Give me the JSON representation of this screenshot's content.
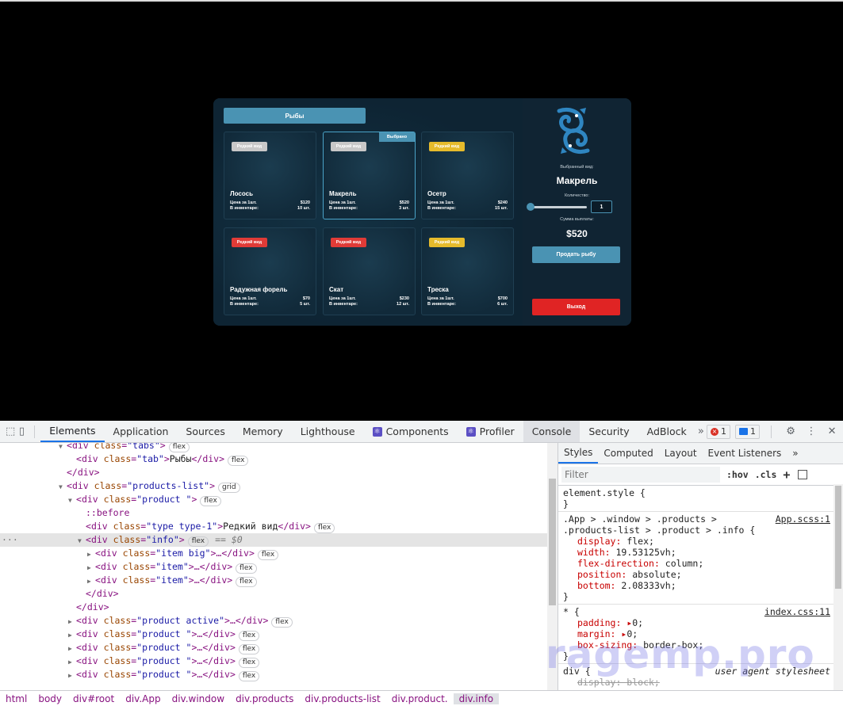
{
  "app": {
    "tab_label": "Рыбы",
    "selected_badge": "Выбрано",
    "price_label": "Цена за 1шт.",
    "inventory_label": "В инвентаре:",
    "products": [
      {
        "name": "Лосось",
        "type_label": "Редкий вид",
        "type_color": "#c8c8c8",
        "price": "$120",
        "qty": "10 шт."
      },
      {
        "name": "Макрель",
        "type_label": "Редкий вид",
        "type_color": "#c8c8c8",
        "price": "$520",
        "qty": "3 шт.",
        "active": true
      },
      {
        "name": "Осетр",
        "type_label": "Редкий вид",
        "type_color": "#e6bb2c",
        "price": "$240",
        "qty": "15 шт."
      },
      {
        "name": "Радужная форель",
        "type_label": "Редкий вид",
        "type_color": "#e03b37",
        "price": "$70",
        "qty": "5 шт."
      },
      {
        "name": "Скат",
        "type_label": "Редкий вид",
        "type_color": "#e03b37",
        "price": "$230",
        "qty": "12 шт."
      },
      {
        "name": "Треска",
        "type_label": "Редкий вид",
        "type_color": "#e6bb2c",
        "price": "$700",
        "qty": "6 шт."
      }
    ],
    "side": {
      "selected_label": "Выбранный вид:",
      "selected_name": "Макрель",
      "quantity_label": "Количество:",
      "quantity_value": "1",
      "payout_label": "Сумма выплаты:",
      "payout_value": "$520",
      "sell_button": "Продать рыбу",
      "exit_button": "Выход"
    }
  },
  "devtools": {
    "tabs": [
      "Elements",
      "Application",
      "Sources",
      "Memory",
      "Lighthouse",
      "Components",
      "Profiler",
      "Console",
      "Security",
      "AdBlock"
    ],
    "more_tabs": "»",
    "error_count": "1",
    "message_count": "1",
    "dom_lines": {
      "l1_tag": "div",
      "l1_attr": "class",
      "l1_val": "\"tabs\"",
      "l1_pill": "flex",
      "l2_tag": "div",
      "l2_attr": "class",
      "l2_val": "\"tab\"",
      "l2_text": "Рыбы",
      "l2_close": "</div>",
      "l2_pill": "flex",
      "l3": "</div>",
      "l4_tag": "div",
      "l4_attr": "class",
      "l4_val": "\"products-list\"",
      "l4_pill": "grid",
      "l5_tag": "div",
      "l5_attr": "class",
      "l5_val": "\"product \"",
      "l5_pill": "flex",
      "l6": "::before",
      "l7_tag": "div",
      "l7_attr": "class",
      "l7_val": "\"type type-1\"",
      "l7_text": "Редкий вид",
      "l7_close": "</div>",
      "l7_pill": "flex",
      "l8_tag": "div",
      "l8_attr": "class",
      "l8_val": "\"info\"",
      "l8_pill": "flex",
      "l8_eq": "== $0",
      "l9_tag": "div",
      "l9_attr": "class",
      "l9_val": "\"item big\"",
      "l9_rest": "…</div>",
      "l9_pill": "flex",
      "l10_tag": "div",
      "l10_attr": "class",
      "l10_val": "\"item\"",
      "l10_rest": "…</div>",
      "l10_pill": "flex",
      "l11_tag": "div",
      "l11_attr": "class",
      "l11_val": "\"item\"",
      "l11_rest": "…</div>",
      "l11_pill": "flex",
      "l12": "</div>",
      "l13": "</div>",
      "l14_tag": "div",
      "l14_attr": "class",
      "l14_val": "\"product active\"",
      "l14_rest": "…</div>",
      "l14_pill": "flex",
      "l15_tag": "div",
      "l15_attr": "class",
      "l15_val": "\"product \"",
      "l15_rest": "…</div>",
      "l15_pill": "flex",
      "l16_tag": "div",
      "l16_attr": "class",
      "l16_val": "\"product \"",
      "l16_rest": "…</div>",
      "l16_pill": "flex",
      "l17_tag": "div",
      "l17_attr": "class",
      "l17_val": "\"product \"",
      "l17_rest": "…</div>",
      "l17_pill": "flex",
      "l18_tag": "div",
      "l18_attr": "class",
      "l18_val": "\"product \"",
      "l18_rest": "…</div>",
      "l18_pill": "flex"
    },
    "breadcrumbs": [
      "html",
      "body",
      "div#root",
      "div.App",
      "div.window",
      "div.products",
      "div.products-list",
      "div.product.",
      "div.info"
    ],
    "styles": {
      "tabs": [
        "Styles",
        "Computed",
        "Layout",
        "Event Listeners"
      ],
      "more": "»",
      "filter_placeholder": "Filter",
      "hov": ":hov",
      "cls": ".cls",
      "element_style": "element.style {",
      "close_brace": "}",
      "rule1_selector_1": ".App > .window > .products >",
      "rule1_selector_2": ".products-list > .product > .info {",
      "rule1_source": "App.scss:1",
      "rule1_props": [
        {
          "name": "display",
          "value": "flex;"
        },
        {
          "name": "width",
          "value": "19.53125vh;"
        },
        {
          "name": "flex-direction",
          "value": "column;"
        },
        {
          "name": "position",
          "value": "absolute;"
        },
        {
          "name": "bottom",
          "value": "2.08333vh;"
        }
      ],
      "rule2_selector": "* {",
      "rule2_source": "index.css:11",
      "rule2_props": [
        {
          "name": "padding",
          "value": "0;"
        },
        {
          "name": "margin",
          "value": "0;"
        },
        {
          "name": "box-sizing",
          "value": "border-box;"
        }
      ],
      "rule3_selector": "div {",
      "rule3_source": "user agent stylesheet",
      "rule3_prop": "display: block;"
    },
    "watermark": "ragemp.pro"
  }
}
